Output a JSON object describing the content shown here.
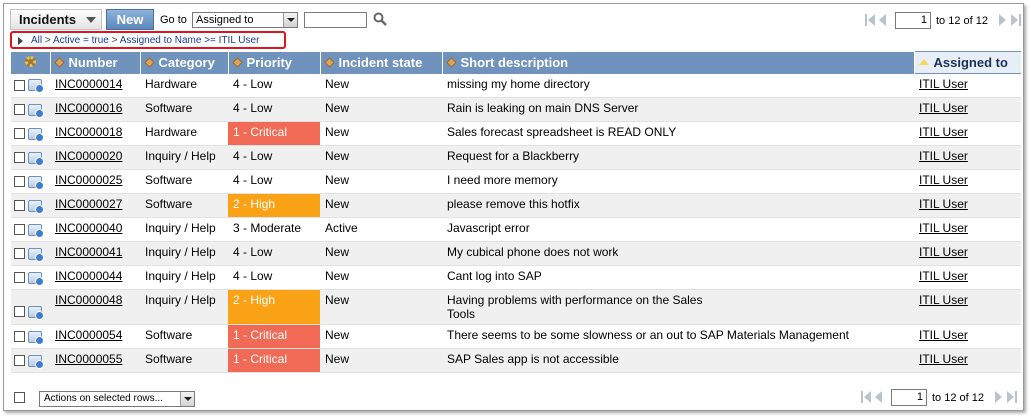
{
  "header": {
    "title": "Incidents",
    "new_label": "New",
    "goto_label": "Go to",
    "goto_field": "Assigned to",
    "goto_value": ""
  },
  "pager": {
    "current_page": "1",
    "range_text": "to 12 of 12"
  },
  "breadcrumb": {
    "root": "All",
    "filters": [
      "Active = true",
      "Assigned to Name >= ITIL User"
    ]
  },
  "columns": [
    "Number",
    "Category",
    "Priority",
    "Incident state",
    "Short description",
    "Assigned to"
  ],
  "rows": [
    {
      "number": "INC0000014",
      "category": "Hardware",
      "priority": "4 - Low",
      "priority_level": "low",
      "state": "New",
      "description": "missing my home directory",
      "description2": "",
      "assigned_to": "ITIL User"
    },
    {
      "number": "INC0000016",
      "category": "Software",
      "priority": "4 - Low",
      "priority_level": "low",
      "state": "New",
      "description": "Rain is leaking on main DNS Server",
      "description2": "",
      "assigned_to": "ITIL User"
    },
    {
      "number": "INC0000018",
      "category": "Hardware",
      "priority": "1 - Critical",
      "priority_level": "critical",
      "state": "New",
      "description": "Sales forecast spreadsheet is READ ONLY",
      "description2": "",
      "assigned_to": "ITIL User"
    },
    {
      "number": "INC0000020",
      "category": "Inquiry / Help",
      "priority": "4 - Low",
      "priority_level": "low",
      "state": "New",
      "description": "Request for a Blackberry",
      "description2": "",
      "assigned_to": "ITIL User"
    },
    {
      "number": "INC0000025",
      "category": "Software",
      "priority": "4 - Low",
      "priority_level": "low",
      "state": "New",
      "description": "I need more memory",
      "description2": "",
      "assigned_to": "ITIL User"
    },
    {
      "number": "INC0000027",
      "category": "Software",
      "priority": "2 - High",
      "priority_level": "high",
      "state": "New",
      "description": "please remove this hotfix",
      "description2": "",
      "assigned_to": "ITIL User"
    },
    {
      "number": "INC0000040",
      "category": "Inquiry / Help",
      "priority": "3 - Moderate",
      "priority_level": "moderate",
      "state": "Active",
      "description": "Javascript error",
      "description2": "",
      "assigned_to": "ITIL User"
    },
    {
      "number": "INC0000041",
      "category": "Inquiry / Help",
      "priority": "4 - Low",
      "priority_level": "low",
      "state": "New",
      "description": "My cubical phone does not work",
      "description2": "",
      "assigned_to": "ITIL User"
    },
    {
      "number": "INC0000044",
      "category": "Inquiry / Help",
      "priority": "4 - Low",
      "priority_level": "low",
      "state": "New",
      "description": "Cant log into SAP",
      "description2": "",
      "assigned_to": "ITIL User"
    },
    {
      "number": "INC0000048",
      "category": "Inquiry / Help",
      "priority": "2 - High",
      "priority_level": "high",
      "state": "New",
      "description": "Having problems with performance on the Sales",
      "description2": "Tools",
      "assigned_to": "ITIL User"
    },
    {
      "number": "INC0000054",
      "category": "Software",
      "priority": "1 - Critical",
      "priority_level": "critical",
      "state": "New",
      "description": "There seems to be some slowness or an out to SAP Materials Management",
      "description2": "",
      "assigned_to": "ITIL User"
    },
    {
      "number": "INC0000055",
      "category": "Software",
      "priority": "1 - Critical",
      "priority_level": "critical",
      "state": "New",
      "description": "SAP Sales app is not accessible",
      "description2": "",
      "assigned_to": "ITIL User"
    }
  ],
  "footer": {
    "actions_label": "Actions on selected rows..."
  },
  "colors": {
    "header_bg": "#6f93bd",
    "critical": "#f06a55",
    "high": "#f9a216",
    "breadcrumb_border": "#e0141e"
  }
}
